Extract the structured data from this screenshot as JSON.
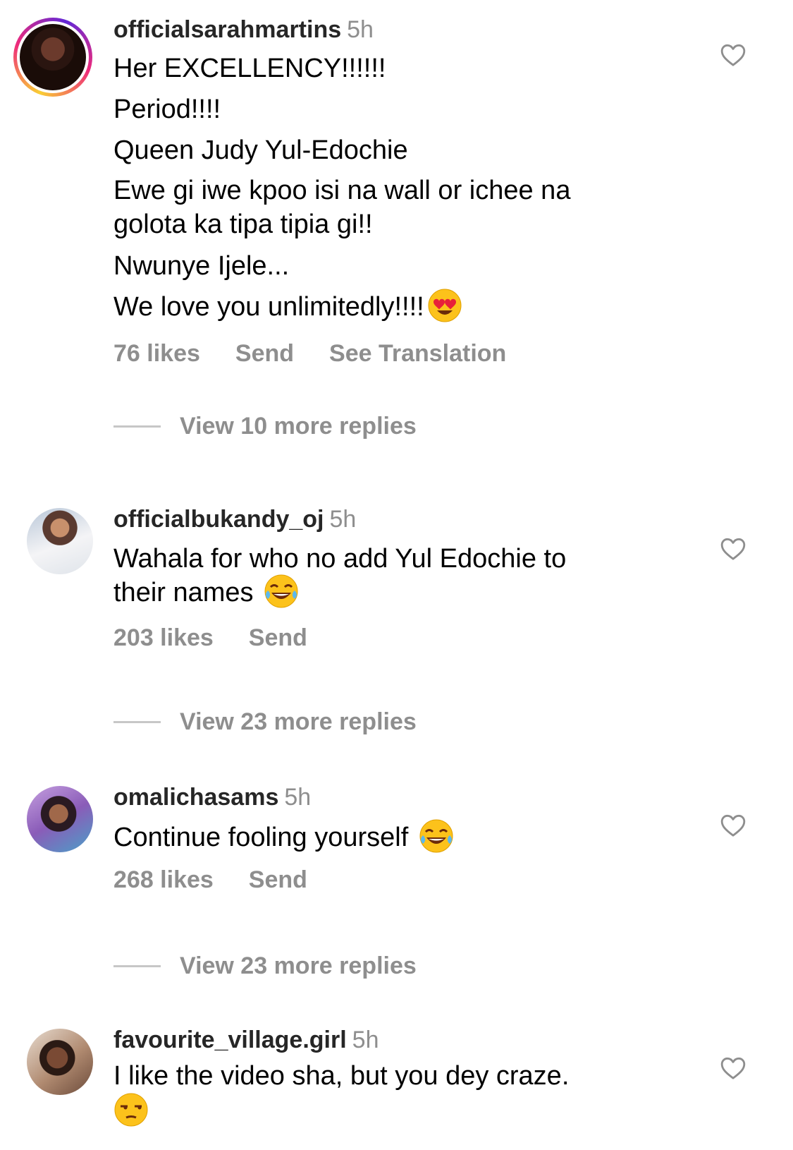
{
  "comments": [
    {
      "username": "officialsarahmartins",
      "time": "5h",
      "lines": [
        "Her EXCELLENCY!!!!!!",
        "Period!!!!",
        "Queen Judy Yul-Edochie",
        "Ewe gi iwe kpoo isi na wall or ichee na",
        "golota ka tipa tipia gi!!",
        "Nwunye Ijele...",
        "We love you unlimitedly!!!!"
      ],
      "emoji": "heart-eyes-emoji",
      "likes": "76 likes",
      "send": "Send",
      "translate": "See Translation",
      "replies": "View 10 more replies"
    },
    {
      "username": "officialbukandy_oj",
      "time": "5h",
      "lines": [
        "Wahala for who no add Yul Edochie to",
        "their names"
      ],
      "emoji": "tears-of-joy-emoji",
      "likes": "203 likes",
      "send": "Send",
      "replies": "View 23 more replies"
    },
    {
      "username": "omalichasams",
      "time": "5h",
      "lines": [
        "Continue fooling yourself"
      ],
      "emoji": "tears-of-joy-emoji",
      "likes": "268 likes",
      "send": "Send",
      "replies": "View 23 more replies"
    },
    {
      "username": "favourite_village.girl",
      "time": "5h",
      "lines": [
        "I like the video sha, but you dey craze."
      ],
      "emoji": "unamused-emoji"
    }
  ],
  "icons": {
    "like": "heart-outline-icon"
  },
  "colors": {
    "secondary_text": "#8e8e8e",
    "story_ring": "#ee2a7b"
  }
}
